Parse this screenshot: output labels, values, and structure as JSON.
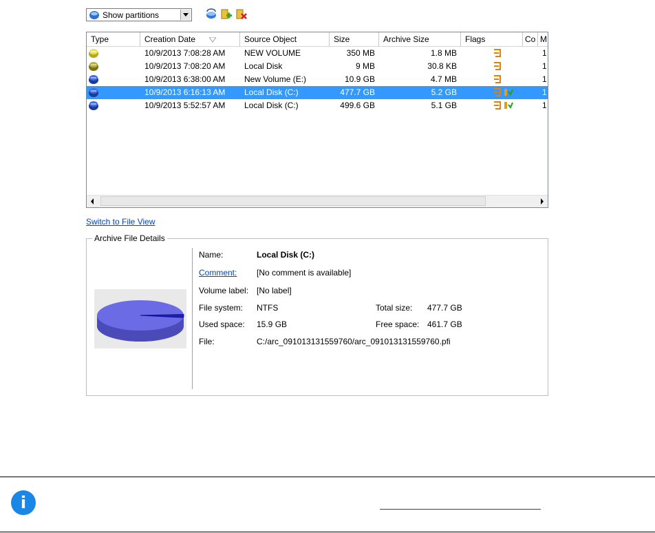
{
  "toolbar": {
    "view_select_value": "Show partitions",
    "buttons": [
      "refresh-icon",
      "add-archive-icon",
      "delete-archive-icon"
    ]
  },
  "columns": [
    "Type",
    "Creation Date",
    "Source Object",
    "Size",
    "Archive Size",
    "Flags",
    "Co",
    "M"
  ],
  "rows": [
    {
      "type_icon": "partition-yellow-icon",
      "creation_date": "10/9/2013 7:08:28 AM",
      "source": "NEW VOLUME",
      "size": "350 MB",
      "archive_size": "1.8 MB",
      "flags": [
        "flag-icon"
      ],
      "m": "1"
    },
    {
      "type_icon": "partition-olive-icon",
      "creation_date": "10/9/2013 7:08:20 AM",
      "source": "Local Disk",
      "size": "9 MB",
      "archive_size": "30.8 KB",
      "flags": [
        "flag-icon"
      ],
      "m": "1"
    },
    {
      "type_icon": "partition-blue-icon",
      "creation_date": "10/9/2013 6:38:00 AM",
      "source": "New Volume (E:)",
      "size": "10.9 GB",
      "archive_size": "4.7 MB",
      "flags": [
        "flag-icon"
      ],
      "m": "1"
    },
    {
      "type_icon": "partition-blue-icon",
      "creation_date": "10/9/2013 6:16:13 AM",
      "source": "Local Disk (C:)",
      "size": "477.7 GB",
      "archive_size": "5.2 GB",
      "flags": [
        "flag-icon",
        "bootable-icon"
      ],
      "m": "1",
      "selected": true
    },
    {
      "type_icon": "partition-blue-icon",
      "creation_date": "10/9/2013 5:52:57 AM",
      "source": "Local Disk (C:)",
      "size": "499.6 GB",
      "archive_size": "5.1 GB",
      "flags": [
        "flag-icon",
        "bootable-icon"
      ],
      "m": "1"
    }
  ],
  "switch_link": "Switch to File View",
  "details": {
    "legend": "Archive File Details",
    "name_label": "Name:",
    "name_value": "Local Disk (C:)",
    "comment_label": "Comment:",
    "comment_value": "[No comment is available]",
    "volume_label_label": "Volume label:",
    "volume_label_value": "[No label]",
    "file_system_label": "File system:",
    "file_system_value": "NTFS",
    "total_size_label": "Total size:",
    "total_size_value": "477.7 GB",
    "used_space_label": "Used space:",
    "used_space_value": "15.9 GB",
    "free_space_label": "Free space:",
    "free_space_value": "461.7 GB",
    "file_label": "File:",
    "file_value": "C:/arc_091013131559760/arc_091013131559760.pfi",
    "usage_fraction": 0.033
  },
  "colors": {
    "selection": "#3399ff",
    "link": "#0645ad",
    "disk_fill": "#6b6be6",
    "info": "#1a87e6"
  }
}
